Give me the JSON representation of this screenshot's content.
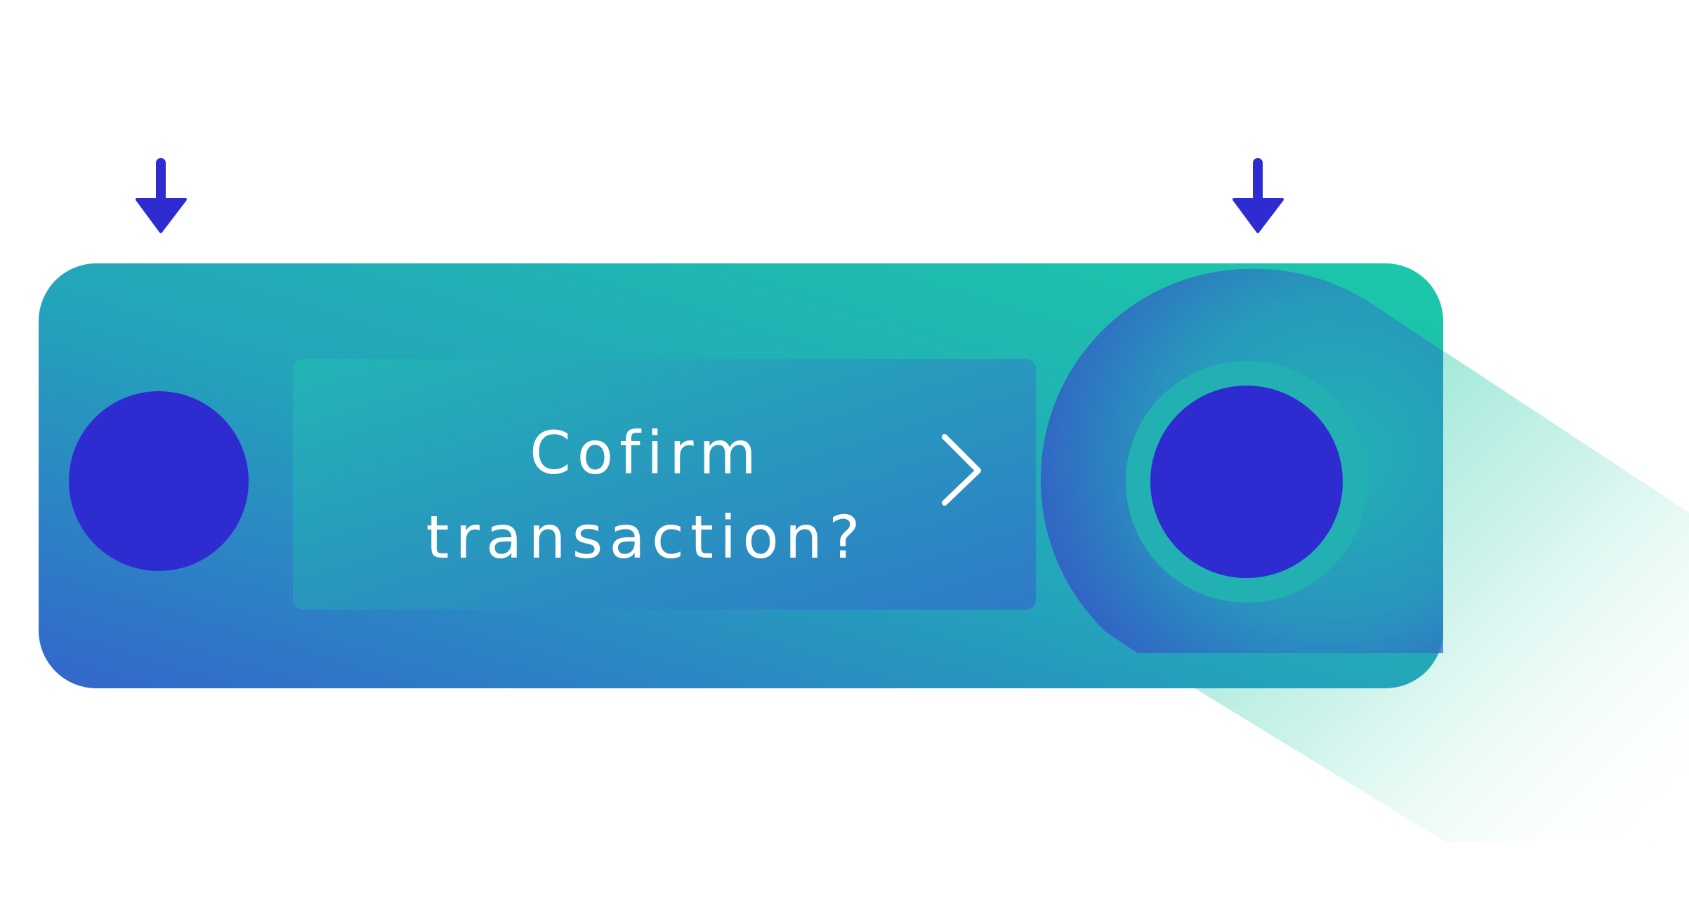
{
  "device": {
    "screen": {
      "line1": "Cofirm",
      "line2": "transaction?"
    }
  },
  "icons": {
    "left_arrow": "arrow-down-icon",
    "right_arrow": "arrow-down-icon",
    "next": "chevron-right-icon"
  },
  "colors": {
    "body_gradient": [
      "#1ec8aa",
      "#2f6fd0"
    ],
    "button": "#2e2bd1",
    "arrow": "#2e2bd1",
    "text": "#ffffff"
  }
}
